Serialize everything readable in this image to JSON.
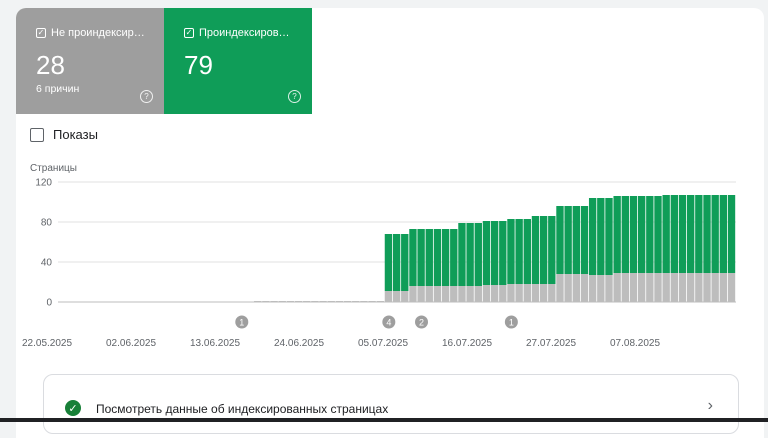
{
  "tiles": {
    "not_indexed": {
      "label": "Не проиндексир…",
      "count": "28",
      "sub": "6 причин"
    },
    "indexed": {
      "label": "Проиндексиров…",
      "count": "79"
    }
  },
  "shows_label": "Показы",
  "link_label": "Посмотреть данные об индексированных страницах",
  "colors": {
    "indexed": "#0f9d58",
    "not_indexed": "#bdbdbd",
    "tile_gray": "#9e9e9e"
  },
  "icons": {
    "check": "checkbox-checked-icon",
    "help": "help-circle-icon",
    "ok": "check-circle-icon",
    "chevron": "chevron-right-icon"
  },
  "chart_data": {
    "type": "bar",
    "stacked": true,
    "ylabel": "Страницы",
    "ylim": [
      0,
      120
    ],
    "yticks": [
      0,
      40,
      80,
      120
    ],
    "x_tick_labels": [
      "22.05.2025",
      "02.06.2025",
      "13.06.2025",
      "24.06.2025",
      "05.07.2025",
      "16.07.2025",
      "27.07.2025",
      "07.08.2025"
    ],
    "series": [
      {
        "name": "Не проиндексированные",
        "values": [
          0,
          0,
          0,
          0,
          0,
          0,
          0,
          0,
          0,
          0,
          0,
          0,
          0,
          0,
          0,
          0,
          0,
          0,
          0,
          0,
          0,
          0,
          0,
          0,
          1,
          1,
          1,
          1,
          1,
          1,
          1,
          1,
          1,
          1,
          1,
          1,
          1,
          1,
          1,
          1,
          11,
          11,
          11,
          16,
          16,
          16,
          16,
          16,
          16,
          16,
          16,
          16,
          17,
          17,
          17,
          18,
          18,
          18,
          18,
          18,
          18,
          28,
          28,
          28,
          28,
          27,
          27,
          27,
          29,
          29,
          29,
          29,
          29,
          29,
          29,
          29,
          29,
          29,
          29,
          29,
          29,
          29,
          29
        ]
      },
      {
        "name": "Проиндексированные",
        "values": [
          0,
          0,
          0,
          0,
          0,
          0,
          0,
          0,
          0,
          0,
          0,
          0,
          0,
          0,
          0,
          0,
          0,
          0,
          0,
          0,
          0,
          0,
          0,
          0,
          0,
          0,
          0,
          0,
          0,
          0,
          0,
          0,
          0,
          0,
          0,
          0,
          0,
          0,
          0,
          0,
          57,
          57,
          57,
          57,
          57,
          57,
          57,
          57,
          57,
          63,
          63,
          63,
          64,
          64,
          64,
          65,
          65,
          65,
          68,
          68,
          68,
          68,
          68,
          68,
          68,
          77,
          77,
          77,
          77,
          77,
          77,
          77,
          77,
          77,
          78,
          78,
          78,
          78,
          78,
          78,
          78,
          78,
          78
        ]
      }
    ],
    "annotations": [
      {
        "label": "1",
        "x_index": 22
      },
      {
        "label": "4",
        "x_index": 40
      },
      {
        "label": "2",
        "x_index": 44
      },
      {
        "label": "1",
        "x_index": 55
      }
    ]
  }
}
